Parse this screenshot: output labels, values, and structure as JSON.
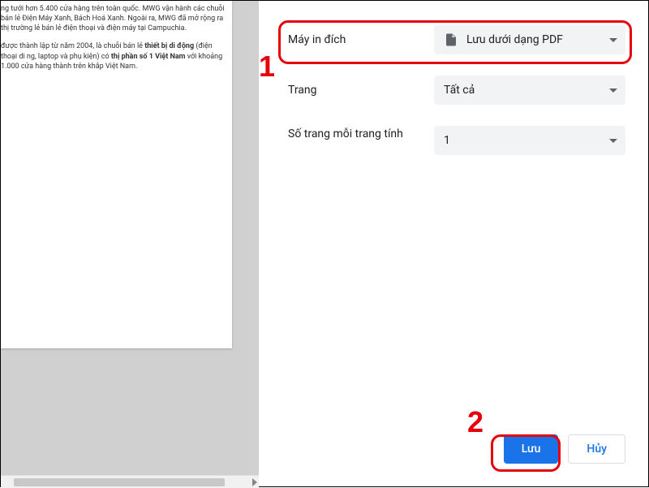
{
  "preview": {
    "para1_pre": "ng tưới hơn 5.400 cửa hàng trên toàn quốc. MWG vận hành các chuỗi bán lẻ Điện Máy Xanh, Bách Hoá Xanh. Ngoài ra, MWG đã mở rộng ra thị trường lẻ bán lẻ điện thoại và điện máy tại Campuchia.",
    "para2_pre": " được thành lập từ năm 2004, là chuỗi bán lẻ ",
    "para2_b1": "thiết bị di động",
    "para2_mid1": " (điện thoại di ng, laptop và phụ kiện) có ",
    "para2_b2": "thị phần số 1 Việt Nam",
    "para2_post": " với khoảng 1.000 cửa hàng thành trên khắp Việt Nam."
  },
  "settings": {
    "destination": {
      "label": "Máy in đích",
      "value": "Lưu dưới dạng PDF"
    },
    "pages": {
      "label": "Trang",
      "value": "Tất cả"
    },
    "per_sheet": {
      "label": "Số trang mỗi trang tính",
      "value": "1"
    }
  },
  "buttons": {
    "save": "Lưu",
    "cancel": "Hủy"
  },
  "callouts": {
    "n1": "1",
    "n2": "2"
  }
}
